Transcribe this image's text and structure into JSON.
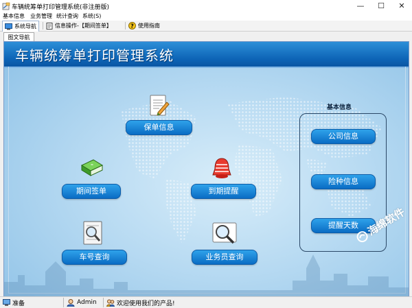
{
  "window": {
    "title": "车辆统筹单打印管理系统(非注册版)",
    "controls": {
      "minimize": "—",
      "maximize": "☐",
      "close": "✕"
    }
  },
  "menu": [
    "基本信息",
    "业务管理",
    "统计查询",
    "系统(S)"
  ],
  "toolbar": {
    "tabs": [
      {
        "label": "系统导航",
        "icon": "monitor-icon",
        "active": true
      },
      {
        "label": "信息操作-【期间签单】",
        "icon": "document-icon",
        "active": false
      },
      {
        "label": "使用指南",
        "icon": "help-icon",
        "active": false
      }
    ]
  },
  "subtab": {
    "label": "图文导航"
  },
  "panel": {
    "app_title": "车辆统筹单打印管理系统",
    "buttons": {
      "policy_info": "保单信息",
      "period_sign": "期间签单",
      "due_reminder": "到期提醒",
      "plate_query": "车号查询",
      "salesman_query": "业务员查询"
    },
    "info_group": {
      "title": "基本信息",
      "buttons": [
        "公司信息",
        "险种信息",
        "提醒天数"
      ]
    }
  },
  "statusbar": {
    "ready": "准备",
    "user": "Admin",
    "welcome": "欢迎使用我们的产品!"
  },
  "watermark": {
    "text": "海绵软件"
  },
  "colors": {
    "header": "#0d64b6",
    "button": "#1a86d6",
    "panel_bg": "#b7daf2"
  }
}
